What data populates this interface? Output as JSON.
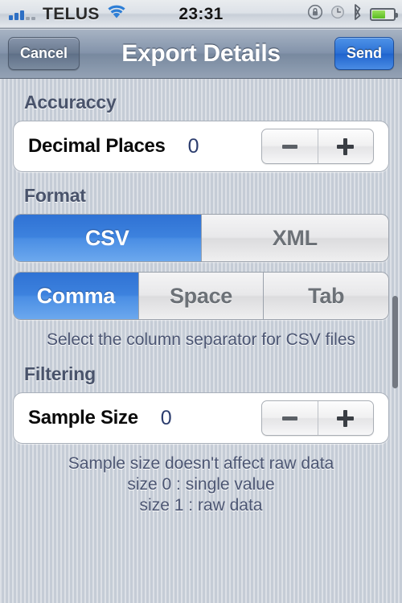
{
  "statusbar": {
    "carrier": "TELUS",
    "time": "23:31",
    "signal_bars_filled": 3,
    "signal_bars_total": 5,
    "icons": [
      "signal-bars",
      "wifi-icon",
      "rotation-lock-icon",
      "alarm-clock-icon",
      "bluetooth-icon",
      "battery-icon"
    ],
    "battery_level_percent": 58
  },
  "navbar": {
    "cancel_label": "Cancel",
    "title": "Export Details",
    "send_label": "Send"
  },
  "sections": {
    "accuracy": {
      "header": "Accuraccy",
      "row_label": "Decimal Places",
      "row_value": "0",
      "stepper": {
        "decrement": "−",
        "increment": "+"
      }
    },
    "format": {
      "header": "Format",
      "file_format_options": [
        {
          "label": "CSV",
          "selected": true
        },
        {
          "label": "XML",
          "selected": false
        }
      ],
      "separator_options": [
        {
          "label": "Comma",
          "selected": true
        },
        {
          "label": "Space",
          "selected": false
        },
        {
          "label": "Tab",
          "selected": false
        }
      ],
      "footer": "Select the column separator for CSV files"
    },
    "filtering": {
      "header": "Filtering",
      "row_label": "Sample Size",
      "row_value": "0",
      "stepper": {
        "decrement": "−",
        "increment": "+"
      },
      "footer_line1": "Sample size doesn't affect raw data",
      "footer_line2": "size 0 : single value",
      "footer_line3": "size 1 : raw data"
    }
  },
  "colors": {
    "accent_blue": "#3d82de",
    "nav_bar": "#8494ab",
    "background": "#c5ccd6",
    "value_text": "#2c3d6e",
    "header_text": "#49536b",
    "battery_green": "#58bb22"
  }
}
